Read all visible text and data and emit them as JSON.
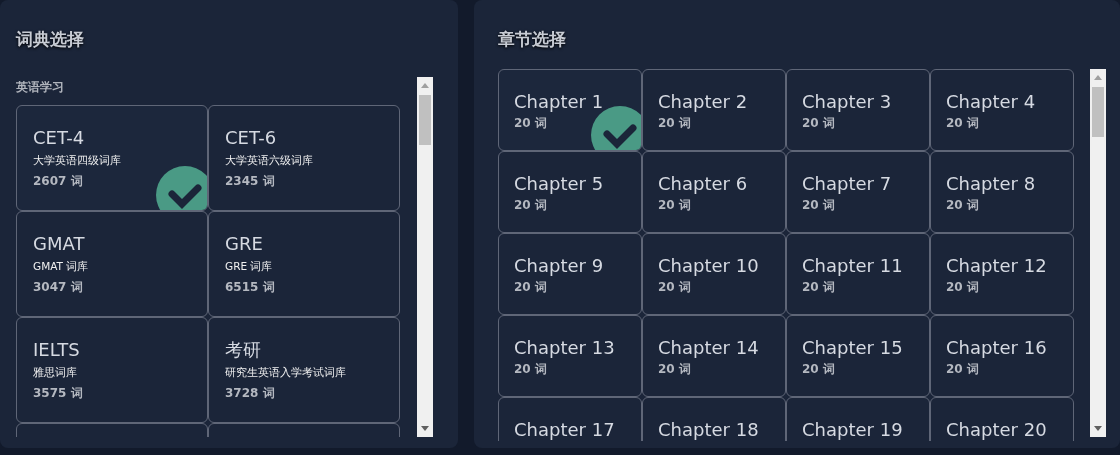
{
  "dictionary_panel": {
    "title": "词典选择",
    "section": "英语学习",
    "dictionaries": [
      {
        "name": "CET-4",
        "description": "大学英语四级词库",
        "count": "2607 词",
        "selected": true
      },
      {
        "name": "CET-6",
        "description": "大学英语六级词库",
        "count": "2345 词",
        "selected": false
      },
      {
        "name": "GMAT",
        "description": "GMAT 词库",
        "count": "3047 词",
        "selected": false
      },
      {
        "name": "GRE",
        "description": "GRE 词库",
        "count": "6515 词",
        "selected": false
      },
      {
        "name": "IELTS",
        "description": "雅思词库",
        "count": "3575 词",
        "selected": false
      },
      {
        "name": "考研",
        "description": "研究生英语入学考试词库",
        "count": "3728 词",
        "selected": false
      }
    ]
  },
  "chapter_panel": {
    "title": "章节选择",
    "chapters": [
      {
        "name": "Chapter 1",
        "count": "20 词",
        "selected": true
      },
      {
        "name": "Chapter 2",
        "count": "20 词",
        "selected": false
      },
      {
        "name": "Chapter 3",
        "count": "20 词",
        "selected": false
      },
      {
        "name": "Chapter 4",
        "count": "20 词",
        "selected": false
      },
      {
        "name": "Chapter 5",
        "count": "20 词",
        "selected": false
      },
      {
        "name": "Chapter 6",
        "count": "20 词",
        "selected": false
      },
      {
        "name": "Chapter 7",
        "count": "20 词",
        "selected": false
      },
      {
        "name": "Chapter 8",
        "count": "20 词",
        "selected": false
      },
      {
        "name": "Chapter 9",
        "count": "20 词",
        "selected": false
      },
      {
        "name": "Chapter 10",
        "count": "20 词",
        "selected": false
      },
      {
        "name": "Chapter 11",
        "count": "20 词",
        "selected": false
      },
      {
        "name": "Chapter 12",
        "count": "20 词",
        "selected": false
      },
      {
        "name": "Chapter 13",
        "count": "20 词",
        "selected": false
      },
      {
        "name": "Chapter 14",
        "count": "20 词",
        "selected": false
      },
      {
        "name": "Chapter 15",
        "count": "20 词",
        "selected": false
      },
      {
        "name": "Chapter 16",
        "count": "20 词",
        "selected": false
      },
      {
        "name": "Chapter 17",
        "selected": false
      },
      {
        "name": "Chapter 18",
        "selected": false
      },
      {
        "name": "Chapter 19",
        "selected": false
      },
      {
        "name": "Chapter 20",
        "selected": false
      }
    ]
  }
}
